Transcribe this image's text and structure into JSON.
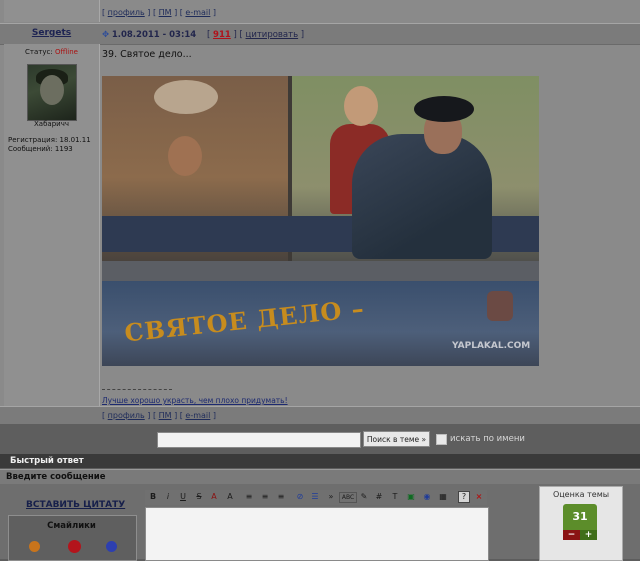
{
  "post_prev": {
    "links": [
      "профиль",
      "ПМ",
      "e-mail"
    ]
  },
  "post": {
    "author": "Sergets",
    "date": "1.08.2011 - 03:14",
    "number": "911",
    "quote_label": "цитировать",
    "status_label": "Статус:",
    "status_value": "Offline",
    "nickname_caption": "Хабаричч",
    "registration": "Регистрация: 18.01.11",
    "messages": "Сообщений: 1193",
    "title": "39. Святое дело...",
    "image_text": {
      "slogan": "СВЯТОЕ ДЕЛО –",
      "watermark": "YAPLAKAL.COM"
    },
    "signature": "Лучше хорошо украсть, чем плохо придумать!",
    "links": [
      "профиль",
      "ПМ",
      "e-mail"
    ]
  },
  "search": {
    "input_value": "",
    "button_label": "Поиск в теме »",
    "by_name_label": "искать по имени"
  },
  "quick_reply": {
    "header": "Быстрый ответ",
    "enter_label": "Введите сообщение",
    "insert_quote": "ВСТАВИТЬ ЦИТАТУ",
    "smileys_label": "Смайлики",
    "editor_value": "",
    "toolbar": [
      "B",
      "i",
      "U",
      "S",
      "A",
      "A",
      "≡",
      "≡",
      "≡",
      "⊘",
      "☰",
      "»",
      "ABC",
      "✎",
      "#",
      "T",
      "▣",
      "◉",
      "▦",
      "?",
      "×"
    ]
  },
  "rating": {
    "label": "Оценка темы",
    "value": "31",
    "minus": "−",
    "plus": "+"
  },
  "colors": {
    "offline": "#aa1111",
    "rating_green": "#5c8d2a",
    "link": "#1d2a70"
  }
}
